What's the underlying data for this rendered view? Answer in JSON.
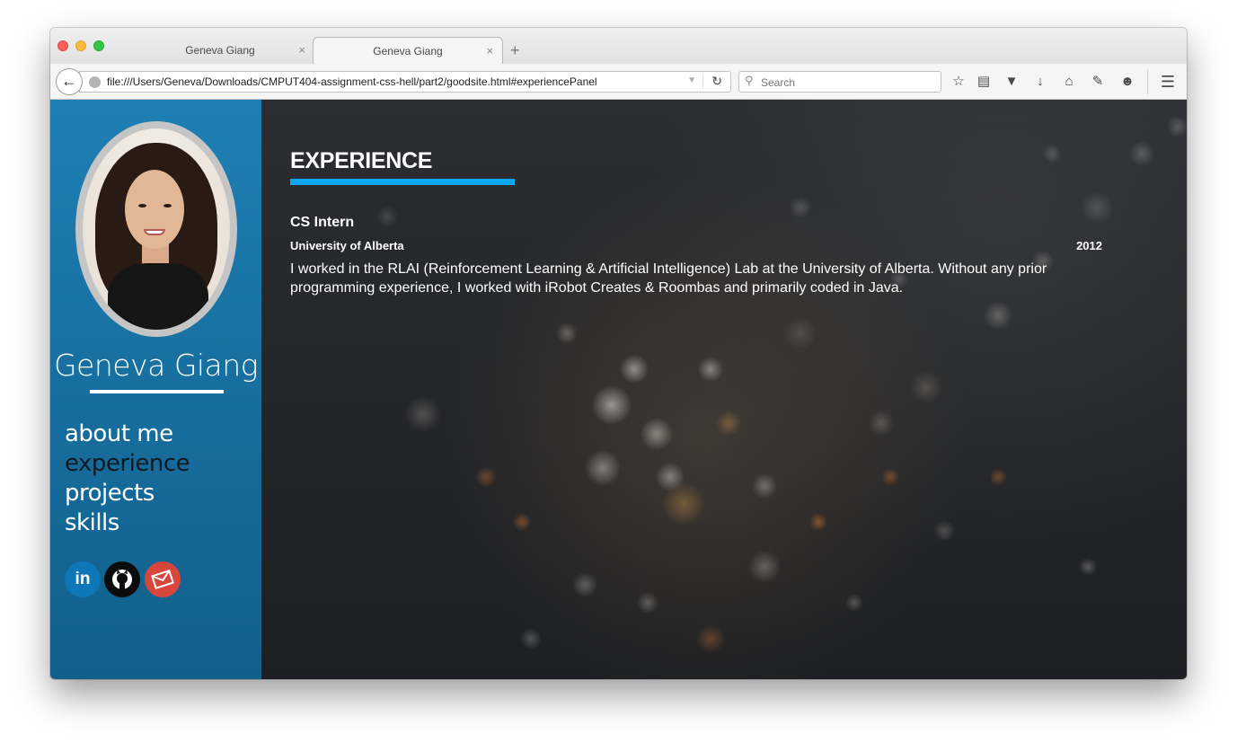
{
  "browser": {
    "tabs": [
      {
        "label": "Geneva Giang",
        "close": "×"
      },
      {
        "label": "Geneva Giang",
        "close": "×"
      }
    ],
    "new_tab": "+",
    "url": "file:///Users/Geneva/Downloads/CMPUT404-assignment-css-hell/part2/goodsite.html#experiencePanel",
    "search_placeholder": "Search"
  },
  "profile": {
    "name": "Geneva Giang"
  },
  "nav": {
    "items": [
      {
        "label": "about me",
        "current": false
      },
      {
        "label": "experience",
        "current": true
      },
      {
        "label": "projects",
        "current": false
      },
      {
        "label": "skills",
        "current": false
      }
    ]
  },
  "social": {
    "linkedin": "in",
    "github": "github",
    "email": "email"
  },
  "experience": {
    "heading": "EXPERIENCE",
    "accent_color": "#0ea7f2",
    "entries": [
      {
        "title": "CS Intern",
        "organization": "University of Alberta",
        "year": "2012",
        "description": "I worked in the RLAI (Reinforcement Learning & Artificial Intelligence) Lab at the University of Alberta. Without any prior programming experience, I worked with iRobot Creates & Roombas and primarily coded in Java."
      }
    ]
  },
  "colors": {
    "sidebar": "#1a74a8",
    "nav_current": "#0f1a22",
    "linkedin": "#0e77b8",
    "github": "#0c0c0c",
    "email": "#d8453b"
  }
}
